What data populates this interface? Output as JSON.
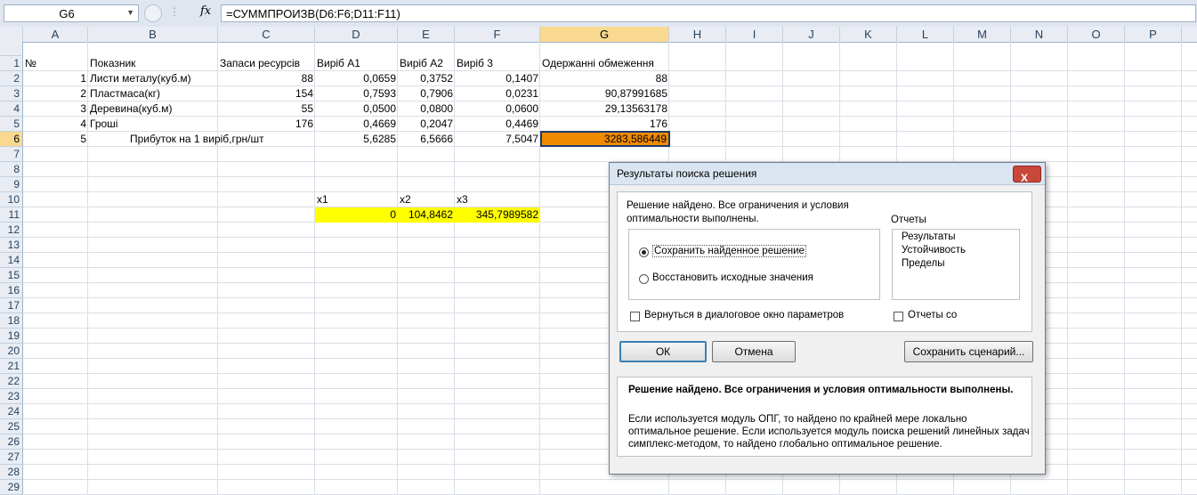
{
  "formula_bar": {
    "name_box": "G6",
    "fx": "fx",
    "formula": "=СУММПРОИЗВ(D6:F6;D11:F11)"
  },
  "columns": [
    "A",
    "B",
    "C",
    "D",
    "E",
    "F",
    "G",
    "H",
    "I",
    "J",
    "K",
    "L",
    "M",
    "N",
    "O",
    "P"
  ],
  "rows": [
    "1",
    "2",
    "3",
    "4",
    "5",
    "6",
    "7",
    "8",
    "9",
    "10",
    "11",
    "12",
    "13",
    "14",
    "15",
    "16",
    "17",
    "18",
    "19",
    "20",
    "21",
    "22",
    "23",
    "24",
    "25",
    "26",
    "27",
    "28",
    "29"
  ],
  "sheet": {
    "header": [
      "№",
      "Показник",
      "Запаси ресурсів",
      "Виріб А1",
      "Виріб А2",
      "Виріб 3",
      "Одержанні обмеження"
    ],
    "data": [
      [
        "1",
        "Листи металу(куб.м)",
        "88",
        "0,0659",
        "0,3752",
        "0,1407",
        "88"
      ],
      [
        "2",
        "Пластмаса(кг)",
        "154",
        "0,7593",
        "0,7906",
        "0,0231",
        "90,87991685"
      ],
      [
        "3",
        "Деревина(куб.м)",
        "55",
        "0,0500",
        "0,0800",
        "0,0600",
        "29,13563178"
      ],
      [
        "4",
        "Гроші",
        "176",
        "0,4669",
        "0,2047",
        "0,4469",
        "176"
      ]
    ],
    "profit_row": [
      "5",
      "Прибуток на 1 виріб,грн/шт",
      "5,6285",
      "6,5666",
      "7,5047",
      "3283,586449"
    ],
    "vars_labels": [
      "x1",
      "x2",
      "x3"
    ],
    "vars_values": [
      "0",
      "104,8462",
      "345,7989582"
    ]
  },
  "dialog": {
    "title": "Результаты поиска решения",
    "close": "X",
    "message_line1": "Решение найдено. Все ограничения и условия",
    "message_line2": "оптимальности выполнены.",
    "reports_label": "Отчеты",
    "reports": [
      "Результаты",
      "Устойчивость",
      "Пределы"
    ],
    "radio_keep": "Сохранить найденное решение",
    "radio_restore": "Восстановить исходные значения",
    "check_return": "Вернуться в диалоговое окно параметров",
    "check_outline": "Отчеты со",
    "btn_ok": "ОК",
    "btn_cancel": "Отмена",
    "btn_save_scenario": "Сохранить сценарий...",
    "info_bold": "Решение найдено. Все ограничения и условия оптимальности выполнены.",
    "info_line1": "Если используется модуль ОПГ, то найдено по крайней мере локально",
    "info_line2": "оптимальное решение. Если используется модуль поиска решений линейных задач",
    "info_line3": "симплекс-методом, то найдено глобально оптимальное решение."
  }
}
